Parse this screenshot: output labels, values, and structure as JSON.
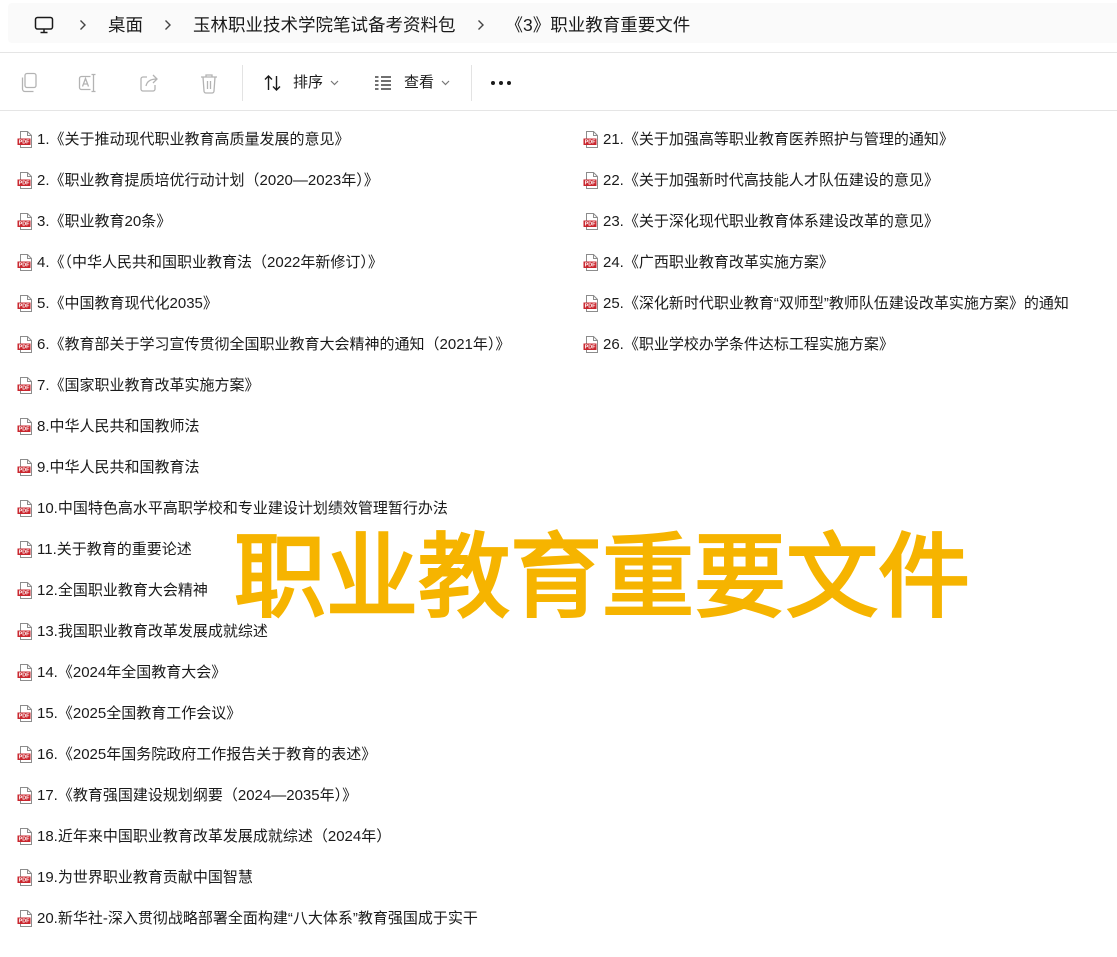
{
  "breadcrumb": {
    "root_icon": "computer-icon",
    "separator_icon": "chevron-right-icon",
    "items": [
      {
        "label": "桌面"
      },
      {
        "label": "玉林职业技术学院笔试备考资料包"
      },
      {
        "label": "《3》职业教育重要文件"
      }
    ]
  },
  "toolbar": {
    "actions": [
      {
        "icon": "copy-icon",
        "enabled": false
      },
      {
        "icon": "rename-icon",
        "enabled": false
      },
      {
        "icon": "share-icon",
        "enabled": false
      },
      {
        "icon": "delete-icon",
        "enabled": false
      }
    ],
    "sort": {
      "icon": "sort-icon",
      "label": "排序",
      "dropdown_icon": "chevron-down-icon"
    },
    "view": {
      "icon": "view-list-icon",
      "label": "查看",
      "dropdown_icon": "chevron-down-icon"
    },
    "more": {
      "icon": "more-icon"
    }
  },
  "file_list": {
    "file_icon": "pdf-file-icon",
    "file_icon_label": "PDF",
    "columns": [
      [
        "1.《关于推动现代职业教育高质量发展的意见》",
        "2.《职业教育提质培优行动计划（2020—2023年）》",
        "3.《职业教育20条》",
        "4.《（中华人民共和国职业教育法（2022年新修订）》",
        "5.《中国教育现代化2035》",
        "6.《教育部关于学习宣传贯彻全国职业教育大会精神的通知（2021年）》",
        "7.《国家职业教育改革实施方案》",
        "8.中华人民共和国教师法",
        "9.中华人民共和国教育法",
        "10.中国特色高水平高职学校和专业建设计划绩效管理暂行办法",
        "11.关于教育的重要论述",
        "12.全国职业教育大会精神",
        "13.我国职业教育改革发展成就综述",
        "14.《2024年全国教育大会》",
        "15.《2025全国教育工作会议》",
        "16.《2025年国务院政府工作报告关于教育的表述》",
        "17.《教育强国建设规划纲要（2024—2035年）》",
        "18.近年来中国职业教育改革发展成就综述（2024年）",
        "19.为世界职业教育贡献中国智慧",
        "20.新华社-深入贯彻战略部署全面构建“八大体系”教育强国成于实干"
      ],
      [
        "21.《关于加强高等职业教育医养照护与管理的通知》",
        "22.《关于加强新时代高技能人才队伍建设的意见》",
        "23.《关于深化现代职业教育体系建设改革的意见》",
        "24.《广西职业教育改革实施方案》",
        "25.《深化新时代职业教育“双师型”教师队伍建设改革实施方案》的通知",
        "26.《职业学校办学条件达标工程实施方案》"
      ]
    ]
  },
  "overlay": {
    "text": "职业教育重要文件"
  },
  "colors": {
    "text": "#1A1A1A",
    "overlay": "#F6B400",
    "pdf_red": "#C9252D",
    "disabled_icon": "#B3B3B3",
    "divider": "#E5E5E5"
  }
}
